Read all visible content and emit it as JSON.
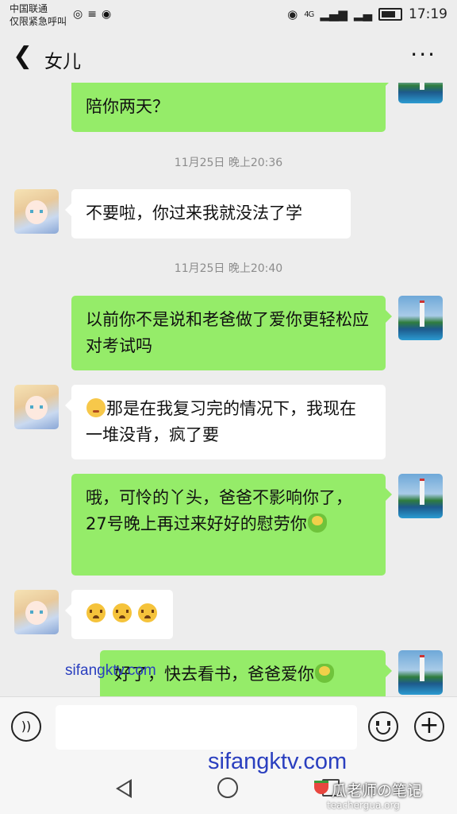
{
  "status_bar": {
    "carrier_line1": "中国联通",
    "carrier_line2": "仅限紧急呼叫",
    "network": "4G",
    "time": "17:19"
  },
  "header": {
    "back_icon": "chevron-left-icon",
    "title": "女儿",
    "more_label": "···"
  },
  "messages": [
    {
      "side": "right",
      "text": "宝宝是有两天才考试要不要爸爸过来陪你两天？",
      "visible_text": "陪你两天？"
    },
    {
      "type": "timestamp",
      "text": "11月25日 晚上20:36"
    },
    {
      "side": "left",
      "text": "不要啦，你过来我就没法了学"
    },
    {
      "type": "timestamp",
      "text": "11月25日 晚上20:40"
    },
    {
      "side": "right",
      "text": "以前你不是说和老爸做了爱你更轻松应对考试吗"
    },
    {
      "side": "left",
      "emoji": "sad-face-emoji",
      "text": "那是在我复习完的情况下，我现在一堆没背，疯了要"
    },
    {
      "side": "right",
      "text": "哦，可怜的丫头，爸爸不影响你了，27号晚上再过来好好的慰劳你",
      "emoji": "hug-emoji"
    },
    {
      "side": "left",
      "emoji": "crying-face-emoji x3",
      "text": ""
    },
    {
      "side": "right",
      "text": "好了，快去看书，爸爸爱你",
      "emoji": "hug-emoji"
    }
  ],
  "watermarks": {
    "chat_wm": "sifangktv.com",
    "bottom_wm": "sifangktv.com",
    "brand": "瓜老师の笔记",
    "brand_url": "teachergua.org"
  },
  "input": {
    "voice_icon": "voice-icon",
    "value": "",
    "emoji_icon": "emoji-icon",
    "plus_label": "+"
  },
  "navbar": {
    "back_icon": "nav-back-icon",
    "home_icon": "nav-home-icon",
    "recent_icon": "nav-recent-icon"
  }
}
